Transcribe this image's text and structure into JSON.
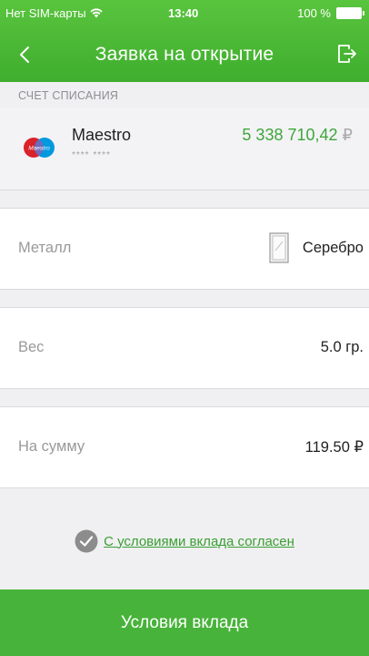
{
  "status_bar": {
    "carrier": "Нет SIM-карты",
    "time": "13:40",
    "battery": "100 %"
  },
  "nav": {
    "title": "Заявка на открытие",
    "back_icon": "chevron-left-icon",
    "exit_icon": "exit-icon"
  },
  "debit_section": {
    "label": "СЧЕТ СПИСАНИЯ"
  },
  "account": {
    "logo_text": "Maestro",
    "name": "Maestro",
    "masked_number": "**** ****",
    "balance": "5 338 710,42",
    "currency": "₽"
  },
  "fields": {
    "metal": {
      "label": "Металл",
      "value": "Серебро"
    },
    "weight": {
      "label": "Вес",
      "value": "5.0 гр."
    },
    "amount": {
      "label": "На сумму",
      "value": "119.50 ₽"
    }
  },
  "agreement": {
    "text": "С условиями вклада согласен",
    "checked": true
  },
  "footer": {
    "button_label": "Условия вклада"
  },
  "colors": {
    "brand_green": "#47b33a",
    "balance_green": "#3fa63a",
    "label_gray": "#999999"
  }
}
